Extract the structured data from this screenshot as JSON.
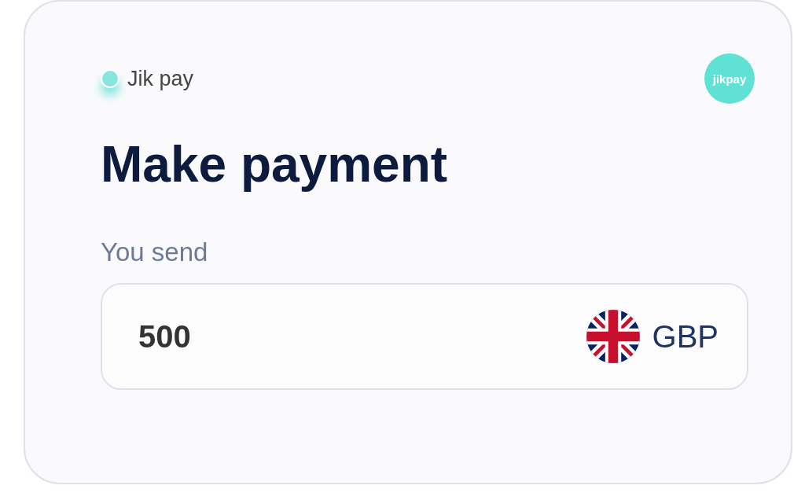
{
  "brand": {
    "name": "Jik pay",
    "logo_text": "jikpay",
    "color": "#86e6df"
  },
  "title": "Make payment",
  "amount_field": {
    "label": "You send",
    "value": "500",
    "currency": "GBP"
  }
}
